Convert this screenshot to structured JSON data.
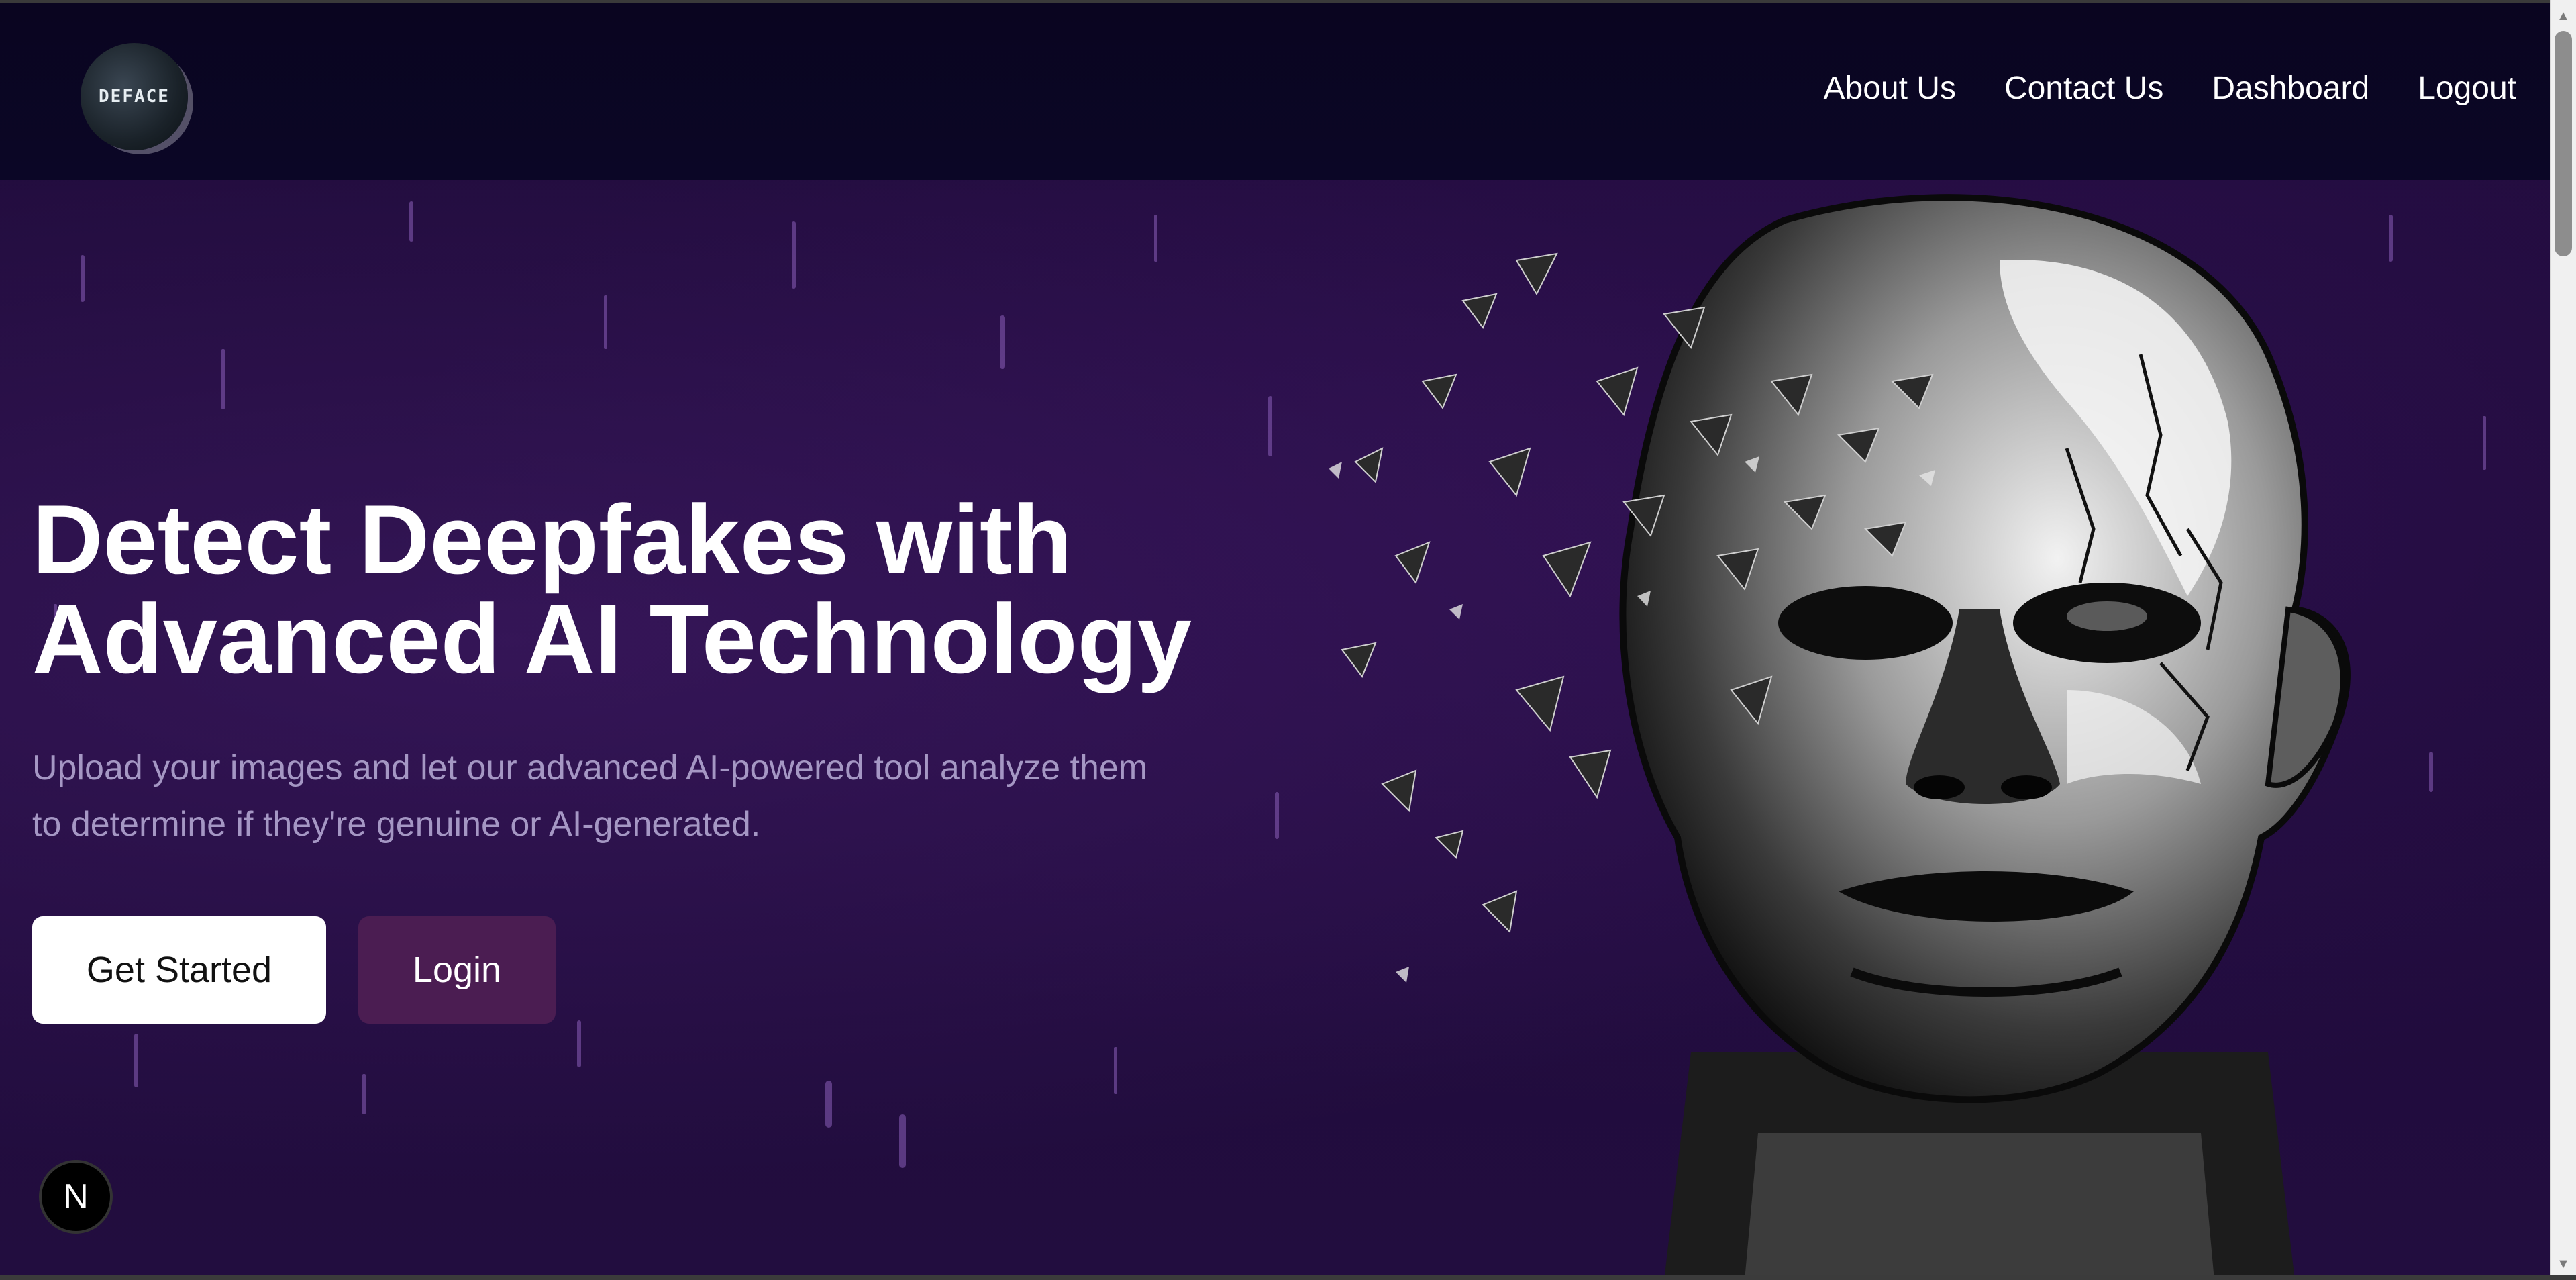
{
  "header": {
    "logo_text": "DEFACE",
    "nav": [
      {
        "label": "About Us"
      },
      {
        "label": "Contact Us"
      },
      {
        "label": "Dashboard"
      },
      {
        "label": "Logout"
      }
    ]
  },
  "hero": {
    "title_line1": "Detect Deepfakes with",
    "title_line2": "Advanced AI Technology",
    "subtitle_line1": "Upload your images and let our advanced AI-powered tool analyze them",
    "subtitle_line2": "to determine if they're genuine or AI-generated.",
    "primary_button": "Get Started",
    "secondary_button": "Login"
  },
  "badge": {
    "label": "N"
  },
  "colors": {
    "background": "#1f0b3a",
    "header_background": "#0b0626",
    "primary_button_bg": "#ffffff",
    "secondary_button_bg": "#4b1d52",
    "subtitle_text": "#a597c4"
  },
  "icons": {
    "logo": "deface-logo-icon",
    "badge": "next-logo-icon",
    "artwork": "shattering-head-illustration"
  }
}
